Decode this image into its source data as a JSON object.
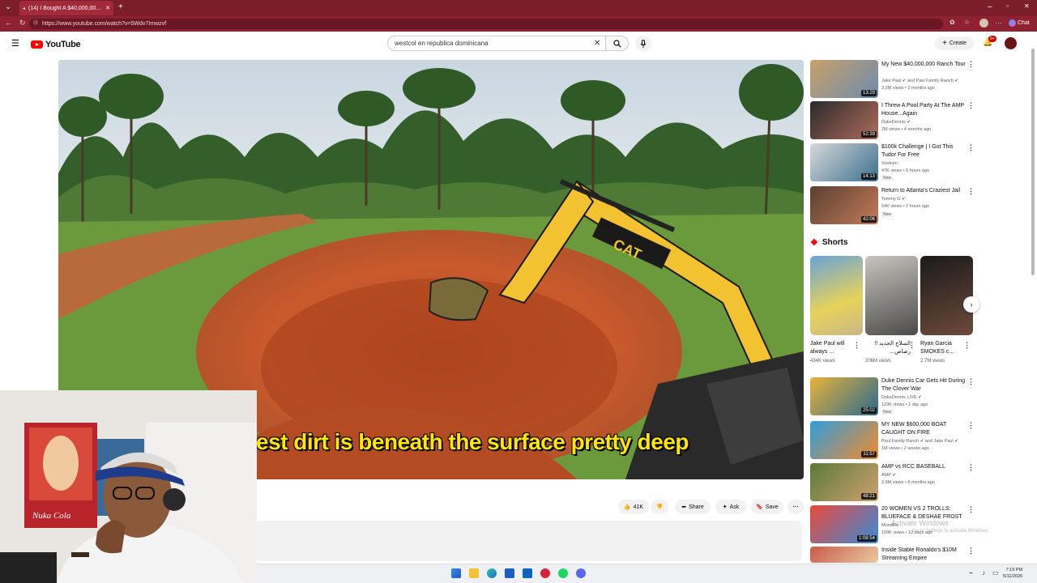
{
  "browser": {
    "tab_title": "(14) I Bought A $40,000,000 R",
    "url": "https://www.youtube.com/watch?v=5Wdv7Imwzvf",
    "profile_chat": "Chat"
  },
  "masthead": {
    "logo_text": "YouTube",
    "search_value": "westcol en republica dominicana",
    "create_label": "Create",
    "notification_count": "9+"
  },
  "player": {
    "caption": "est dirt is beneath the surface pretty deep",
    "machine_brand": "CAT"
  },
  "actions": {
    "like_count": "41K",
    "share_label": "Share",
    "ask_label": "Ask",
    "save_label": "Save"
  },
  "sidebar": {
    "videos_top": [
      {
        "title": "My New $40,000,000 Ranch Tour",
        "channel": "Jake Paul",
        "channel2": "and Paul Family Ranch",
        "meta": "3.2M views • 2 months ago",
        "duration": "13:29",
        "badge": ""
      },
      {
        "title": "I Threw A Pool Party At The AMP House...Again",
        "channel": "DukeDennis",
        "channel2": "",
        "meta": "2M views • 4 months ago",
        "duration": "52:39",
        "badge": ""
      },
      {
        "title": "$100k Challenge | I Got This Tudor For Free",
        "channel": "Vookum",
        "channel2": "",
        "meta": "47K views • 5 hours ago",
        "duration": "14:13",
        "badge": "New"
      },
      {
        "title": "Return to Atlanta's Craziest Jail",
        "channel": "Tommy G",
        "channel2": "",
        "meta": "54K views • 2 hours ago",
        "duration": "42:06",
        "badge": "New"
      }
    ],
    "shorts_heading": "Shorts",
    "shorts": [
      {
        "title": "Jake Paul will always ...",
        "views": "434K views"
      },
      {
        "title": "السلاح الجديد !! رصاص...",
        "views": "206M views"
      },
      {
        "title": "Ryan Garcia SMOKES c...",
        "views": "2.7M views"
      }
    ],
    "videos_bottom": [
      {
        "title": "Duke Dennis Car Gets Hit During The Clover War",
        "channel": "DukeDennis LIVE",
        "channel2": "",
        "meta": "123K views • 1 day ago",
        "duration": "25:02",
        "badge": "New"
      },
      {
        "title": "MY NEW $600,000 BOAT CAUGHT ON FIRE",
        "channel": "Paul Family Ranch",
        "channel2": "and Jake Paul",
        "meta": "1M views • 2 weeks ago",
        "duration": "11:57",
        "badge": ""
      },
      {
        "title": "AMP vs RCC BASEBALL",
        "channel": "AMP",
        "channel2": "",
        "meta": "2.9M views • 6 months ago",
        "duration": "48:21",
        "badge": ""
      },
      {
        "title": "20 WOMEN VS 2 TROLLS: BLUEFACE & DESHAE FROST",
        "channel": "Monaflix",
        "channel2": "",
        "meta": "109K views • 13 days ago",
        "duration": "1:08:54",
        "badge": ""
      },
      {
        "title": "Inside Stable Ronaldo's $10M Streaming Empire",
        "channel": "",
        "channel2": "",
        "meta": "",
        "duration": "",
        "badge": ""
      }
    ]
  },
  "os": {
    "watermark": "Activate Windows",
    "watermark_sub": "Go to Settings to activate Windows.",
    "time": "7:19 PM",
    "date": "5/11/2026"
  },
  "webcam": {
    "poster_text": "Nuka Cola"
  },
  "colors": {
    "browser_frame": "#8f2232",
    "yt_red": "#ff0000",
    "caption_yellow": "#ffe600",
    "excavator_yellow": "#f2c230"
  }
}
